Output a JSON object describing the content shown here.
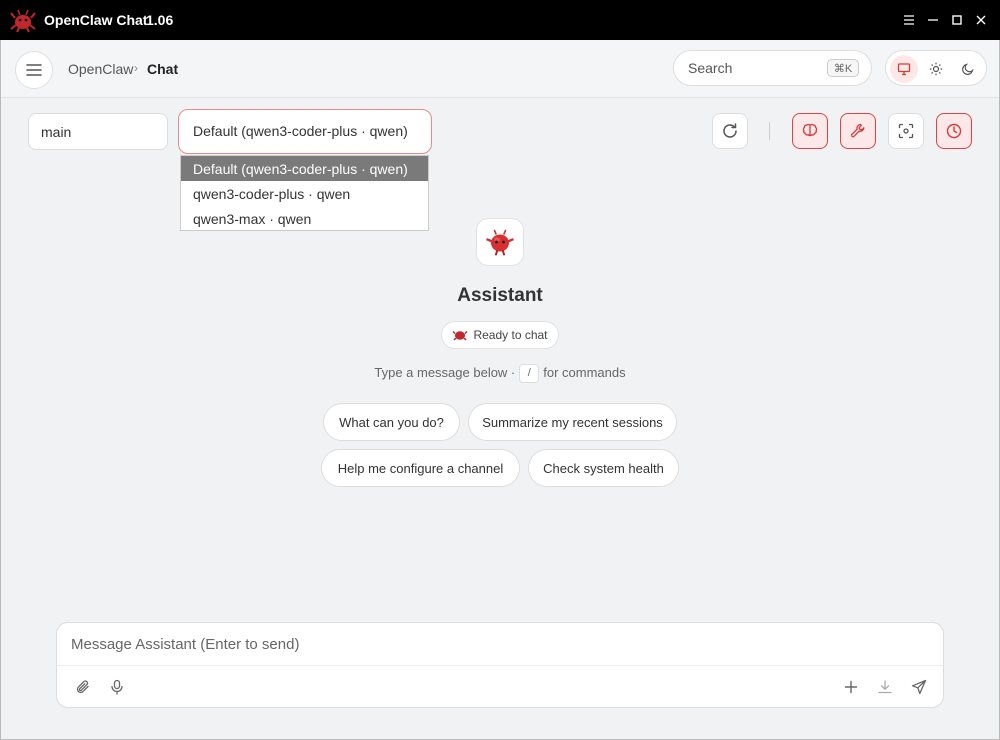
{
  "window": {
    "title": "OpenClaw Chat",
    "version": "1.06",
    "controls": [
      "menu",
      "minimize",
      "maximize",
      "close"
    ]
  },
  "header": {
    "breadcrumb_root": "OpenClaw",
    "breadcrumb_separator": "›",
    "breadcrumb_current": "Chat",
    "search_placeholder": "Search",
    "search_shortcut": "⌘K",
    "theme_options": [
      "system",
      "light",
      "dark"
    ],
    "theme_selected": "system"
  },
  "toolbar": {
    "agent_value": "main",
    "model_value": "Default (qwen3-coder-plus · qwen)",
    "model_options": [
      "Default (qwen3-coder-plus · qwen)",
      "qwen3-coder-plus · qwen",
      "qwen3-max · qwen"
    ],
    "buttons": [
      {
        "icon": "refresh-icon",
        "active": false
      },
      {
        "icon": "brain-icon",
        "active": true
      },
      {
        "icon": "wrench-icon",
        "active": true
      },
      {
        "icon": "focus-icon",
        "active": false
      },
      {
        "icon": "clock-icon",
        "active": true
      }
    ]
  },
  "welcome": {
    "name": "Assistant",
    "status": "Ready to chat",
    "hint_before": "Type a message below ·",
    "hint_key": "/",
    "hint_after": "for commands",
    "suggestions": [
      "What can you do?",
      "Summarize my recent sessions",
      "Help me configure a channel",
      "Check system health"
    ]
  },
  "composer": {
    "placeholder": "Message Assistant (Enter to send)"
  },
  "colors": {
    "accent": "#d63b3b",
    "accent_bg": "#fce8e8",
    "titlebar": "#000000",
    "background": "#f1f2f4"
  }
}
